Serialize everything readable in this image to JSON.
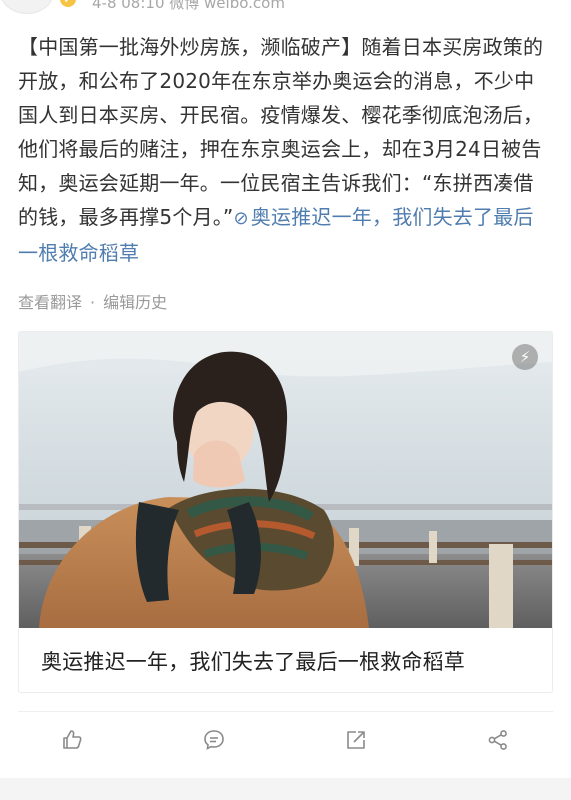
{
  "post": {
    "meta": "4-8 08:10  微博 weibo.com",
    "text_before_link": "【中国第一批海外炒房族，濒临破产】随着日本买房政策的开放，和公布了2020年在东京举办奥运会的消息，不少中国人到日本买房、开民宿。疫情爆发、樱花季彻底泡汤后，他们将最后的赌注，押在东京奥运会上，却在3月24日被告知，奥运会延期一年。一位民宿主告诉我们：“东拼西凑借的钱，最多再撑5个月。”",
    "link_text": "奥运推迟一年，我们失去了最后一根救命稻草",
    "actions": {
      "translate": "查看翻译",
      "separator": "·",
      "edit_history": "编辑历史"
    }
  },
  "card": {
    "title": "奥运推迟一年，我们失去了最后一根救命稻草",
    "image_icon": "lightning-icon"
  },
  "bottom_bar": {
    "icons": [
      "like-icon",
      "comment-icon",
      "repost-icon",
      "share-icon"
    ]
  },
  "colors": {
    "link": "#507daf",
    "text": "#333333",
    "muted": "#9a9a9a"
  }
}
